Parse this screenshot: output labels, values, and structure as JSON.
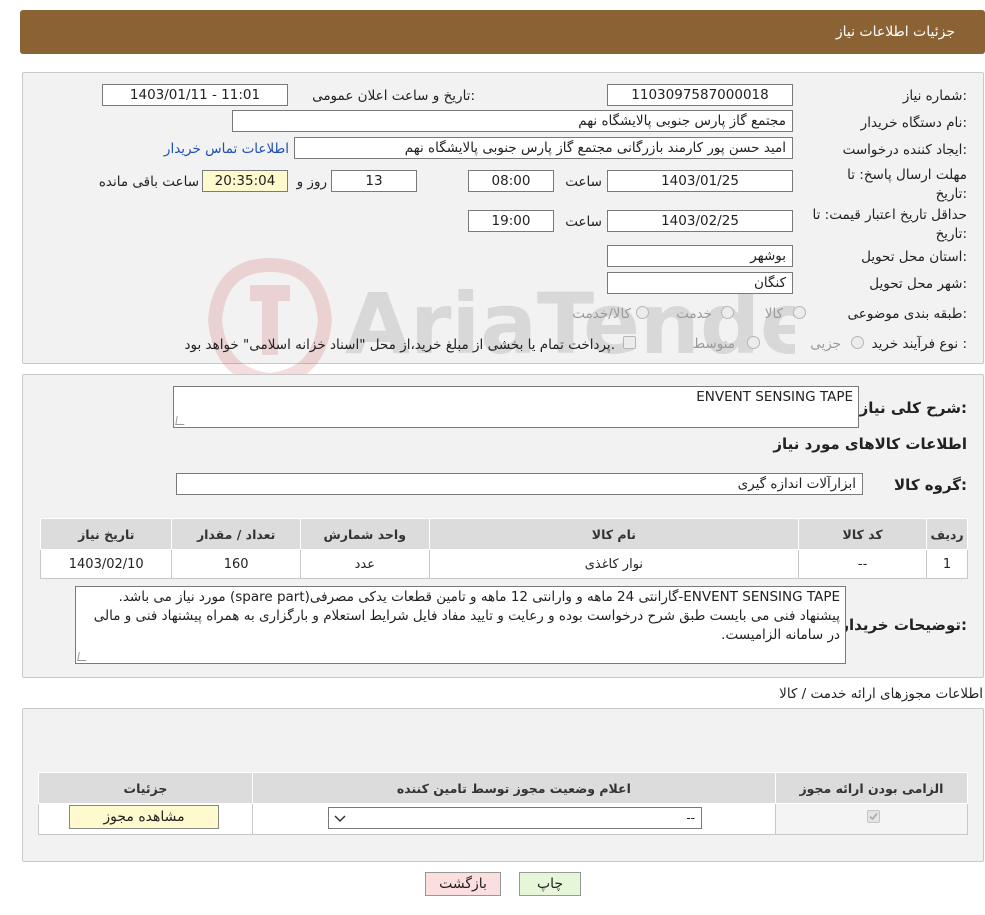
{
  "header": {
    "title": "جزئیات اطلاعات نیاز"
  },
  "form": {
    "need_number_label": "شماره نیاز:",
    "need_number": "1103097587000018",
    "announce_label": "تاریخ و ساعت اعلان عمومی:",
    "announce_value": "1403/01/11 - 11:01",
    "buyer_org_label": "نام دستگاه خریدار:",
    "buyer_org": "مجتمع گاز پارس جنوبی  پالایشگاه نهم",
    "requester_label": "ایجاد کننده درخواست:",
    "requester": "امید حسن پور کارمند بازرگانی مجتمع گاز پارس جنوبی  پالایشگاه نهم",
    "contact_link": "اطلاعات تماس خریدار",
    "reply_deadline_label": "مهلت ارسال پاسخ: تا تاریخ:",
    "reply_date": "1403/01/25",
    "time_label": "ساعت",
    "reply_time": "08:00",
    "days_value": "13",
    "days_label": "روز و",
    "remaining_time": "20:35:04",
    "remaining_label": "ساعت باقی مانده",
    "price_validity_label": "حداقل تاریخ اعتبار قیمت: تا تاریخ:",
    "validity_date": "1403/02/25",
    "validity_time": "19:00",
    "province_label": "استان محل تحویل:",
    "province": "بوشهر",
    "city_label": "شهر محل تحویل:",
    "city": "کنگان",
    "category_label": "طبقه بندی موضوعی:",
    "category_options": [
      "کالا",
      "خدمت",
      "کالا/خدمت"
    ],
    "process_label": "نوع فرآیند خرید :",
    "process_options": [
      "جزیی",
      "متوسط"
    ],
    "payment_note": "پرداخت تمام یا بخشی از مبلغ خرید،از محل \"اسناد خزانه اسلامی\" خواهد بود."
  },
  "details": {
    "summary_label": "شرح کلی نیاز:",
    "summary_value": "ENVENT SENSING TAPE",
    "goods_info_title": "اطلاعات کالاهای مورد نیاز",
    "group_label": "گروه کالا:",
    "group_value": "ابزارآلات اندازه گیری",
    "table_headers": [
      "ردیف",
      "کد کالا",
      "نام کالا",
      "واحد شمارش",
      "تعداد / مقدار",
      "تاریخ نیاز"
    ],
    "rows": [
      {
        "row": "1",
        "code": "--",
        "name": "نوار کاغذی",
        "unit": "عدد",
        "qty": "160",
        "date": "1403/02/10"
      }
    ],
    "buyer_notes_label": "توضیحات خریدار:",
    "buyer_notes": "ENVENT SENSING TAPE-گارانتی 24 ماهه و وارانتی 12 ماهه و تامین قطعات یدکی مصرفی(spare part) مورد نیاز می باشد. پیشنهاد فنی می بایست طبق شرح درخواست بوده و رعایت و تایید مفاد فایل شرایط استعلام و بارگزاری به همراه پیشنهاد فنی و مالی در سامانه الزامیست."
  },
  "permits": {
    "section_title": "اطلاعات مجوزهای ارائه خدمت / کالا",
    "headers": [
      "الزامی بودن ارائه مجوز",
      "اعلام وضعیت مجوز توسط تامین کننده",
      "جزئیات"
    ],
    "select_value": "--",
    "view_button": "مشاهده مجوز"
  },
  "footer": {
    "print_button": "چاپ",
    "back_button": "بازگشت"
  },
  "watermark": {
    "text": "AriaTender.neT"
  },
  "colors": {
    "header_bg": "#8b6234",
    "panel_bg": "#f2f2f2",
    "link": "#1e4fb5",
    "print_bg": "#e6f7d9",
    "back_bg": "#fbdede"
  }
}
